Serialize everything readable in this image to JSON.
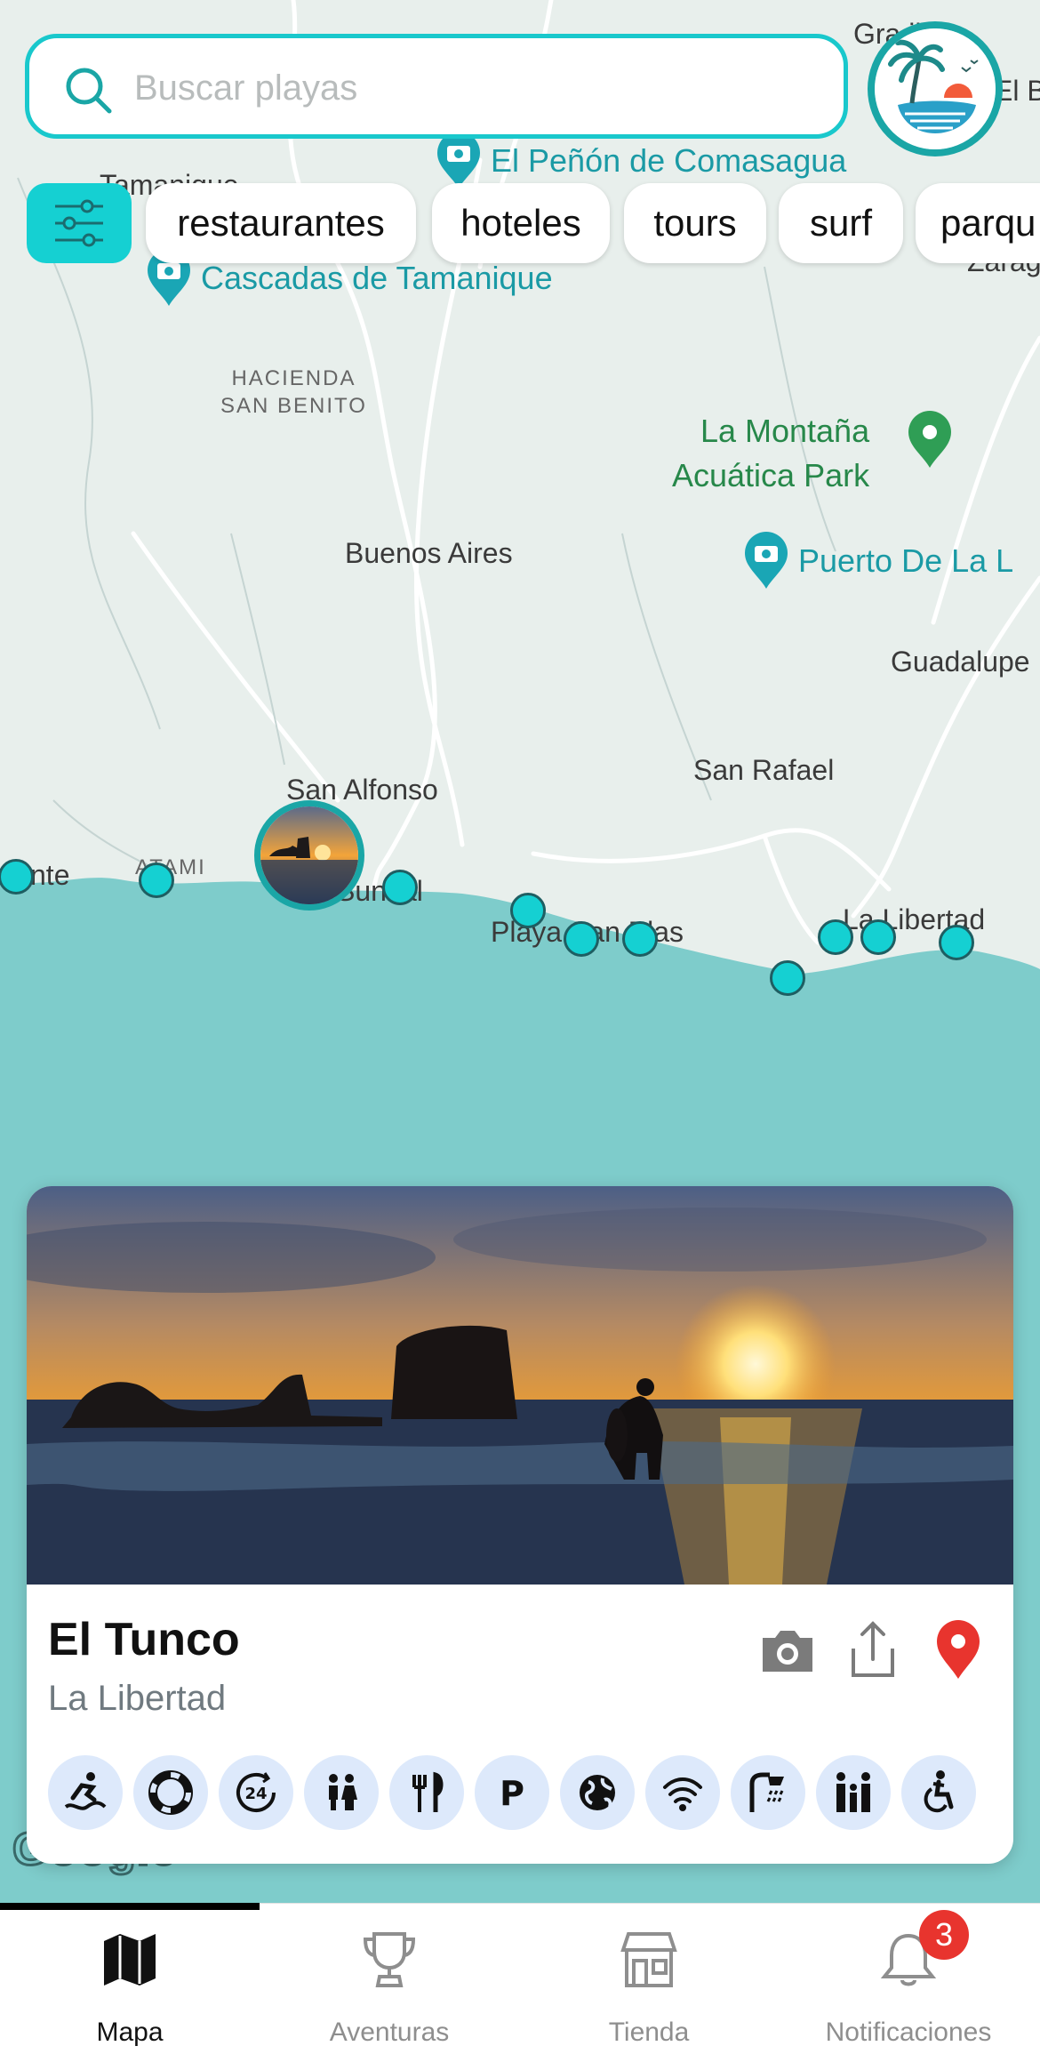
{
  "search": {
    "placeholder": "Buscar playas"
  },
  "filters": {
    "chips": [
      "restaurantes",
      "hoteles",
      "tours",
      "surf",
      "parqu"
    ]
  },
  "map": {
    "places": {
      "gran_villas": "Gra  illas",
      "el_b": "El B",
      "tamanique": "Tamanique",
      "zaragoza": "Zarag",
      "hacienda": "HACIENDA\nSAN BENITO",
      "buenos_aires": "Buenos Aires",
      "guadalupe": "Guadalupe",
      "san_rafael": "San Rafael",
      "san_alfonso": "San Alfonso",
      "nte": "nte",
      "atami": "ATAMI",
      "sunzal": "Sunzal",
      "playa_san_blas": "Playa San Blas",
      "la_libertad": "La Libertad"
    },
    "pois": {
      "penon": "El Peñón de Comasagua",
      "cascadas": "Cascadas de Tamanique",
      "montana_line1": "La Montaña",
      "montana_line2": "Acuática Park",
      "puerto": "Puerto De La L"
    },
    "attribution": "Google"
  },
  "beach_card": {
    "name": "El Tunco",
    "region": "La Libertad",
    "actions": [
      "camera-icon",
      "share-icon",
      "location-pin-icon"
    ],
    "amenities": [
      "surf-icon",
      "lifeguard-icon",
      "24-hours-icon",
      "restroom-icon",
      "restaurant-icon",
      "parking-icon",
      "globe-icon",
      "wifi-icon",
      "shower-icon",
      "family-icon",
      "accessibility-icon"
    ]
  },
  "tabs": [
    {
      "label": "Mapa",
      "icon": "map-icon",
      "active": true
    },
    {
      "label": "Aventuras",
      "icon": "trophy-icon",
      "active": false
    },
    {
      "label": "Tienda",
      "icon": "store-icon",
      "active": false
    },
    {
      "label": "Notificaciones",
      "icon": "bell-icon",
      "active": false
    }
  ],
  "notifications": {
    "badge_count": "3"
  },
  "colors": {
    "accent": "#15d0d2",
    "ocean": "#7ecccb",
    "land": "#e8efec",
    "badge": "#e8342e",
    "amenity_bg": "#dde9fb"
  }
}
